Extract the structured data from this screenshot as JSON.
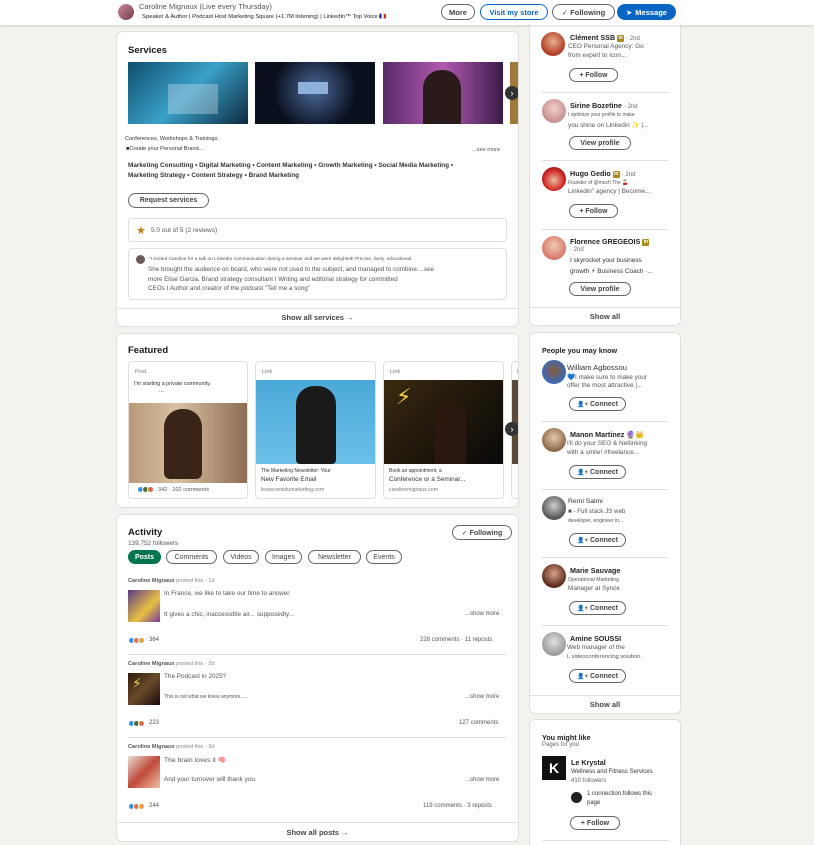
{
  "topbar": {
    "name": "Caroline Mignaux (Live every Thursday)",
    "headline": "Speaker & Author | Podcast Host Marketing Square (+1.7M listening) | LinkedIn™ Top Voice 🇫🇷",
    "more_label": "More",
    "store_label": "Visit my store",
    "following_label": "✓ Following",
    "message_label": "Message"
  },
  "services": {
    "title": "Services",
    "desc_line1": "Conferences, Workshops & Trainings:",
    "desc_line2": "■Create your Personal Brand...",
    "see_more": "...see more",
    "tags_line1": "Marketing Consulting • Digital Marketing • Content Marketing • Growth Marketing • Social Media Marketing •",
    "tags_line2": "Marketing Strategy • Content Strategy • Brand Marketing",
    "request_label": "Request services",
    "rating": "5.0 out of 5 (2 reviews)",
    "review_head": "\"I invited Caroline for a talk on LinkedIn communication during a seminar and we were delighted! Precise, lively, educational.",
    "review_l1": "She brought the audience on board, who were not used to the subject, and managed to combine....see",
    "review_l2": "more Elise Garcia, Brand strategy consultant I Writing and editorial strategy for committed",
    "review_l3": "CEOs I Author and creator of the podcast \"Tell me a song\"",
    "show_all": "Show all services →"
  },
  "featured": {
    "title": "Featured",
    "items": [
      {
        "type": "Post",
        "text": "I'm starting a private community.",
        "dots": "...",
        "reactions": "342 · 102 comments"
      },
      {
        "type": "Link",
        "caption1": "The Marketing Newsletter: Your",
        "caption2": "New Favorite Email",
        "domain": "lessecretsdumarketing.com"
      },
      {
        "type": "Link",
        "caption1": "Book an appointment, a",
        "caption2": "Conference or a Seminar...",
        "domain": "carolinemignaux.com"
      },
      {
        "type": "L"
      }
    ]
  },
  "activity": {
    "title": "Activity",
    "followers": "139,752 followers",
    "following_label": "✓ Following",
    "tabs": [
      "Posts",
      "Comments",
      "Videos",
      "Images",
      "Newsletter",
      "Events"
    ],
    "posts": [
      {
        "author": "Caroline Mignaux",
        "meta": " posted this · 1d",
        "l1": "In France, we like to take our time to answer.",
        "l2": "It gives a chic, inaccessible air... supposedly...",
        "more": "...show more",
        "count": "364",
        "stats": "228 comments · 11 reposts"
      },
      {
        "author": "Caroline Mignaux",
        "meta": " posted this · 2d",
        "l1": "The Podcast in 2025?",
        "l2": "This is not what we knew anymore.....",
        "more": "...show more",
        "count": "223",
        "stats": "127 comments"
      },
      {
        "author": "Caroline Mignaux",
        "meta": " posted this · 3d",
        "l1": "The brain loves it 🧠",
        "l2": "And your turnover will thank you.",
        "more": "...show more",
        "count": "244",
        "stats": "119 comments · 3 reposts"
      }
    ],
    "show_all": "Show all posts →"
  },
  "sidebar_top": {
    "people": [
      {
        "name": "Clément SSB",
        "degree": "· 2nd",
        "l1": "CEO Personal Agency: Go",
        "l2": "from expert to icon...",
        "button": "+ Follow"
      },
      {
        "name": "Sirine Bozetine",
        "degree": "· 2nd",
        "l1": "I optimize your profile to make",
        "l2": "you shine on Linkedin ✨ |...",
        "button": "View profile"
      },
      {
        "name": "Hugo Gedio",
        "degree": "· 2nd",
        "l1": "Founder of @much The 🍒",
        "l2": "Linkedin\" agency | Become...",
        "button": "+ Follow"
      },
      {
        "name": "Florence GREGEOIS",
        "degree": "· 2nd",
        "l1": "I skyrocket your business",
        "l2": "growth ⚡ Business Coach ·...",
        "button": "View profile"
      }
    ],
    "show_all": "Show all"
  },
  "pymk": {
    "title": "People you may know",
    "people": [
      {
        "name": "William Agbossou",
        "l1": "💙I make sure to make your",
        "l2": "offer the most attractive |...",
        "button": "Connect"
      },
      {
        "name": "Manon Martinez 🔮👑",
        "l1": "I'll do your SEO & Netlinking",
        "l2": "with a smile! #freelance...",
        "button": "Connect"
      },
      {
        "name": "Remi Salmi",
        "l1": "■ - Full stack JS web",
        "l2": "developer, engineer in...",
        "button": "Connect"
      },
      {
        "name": "Marie Sauvage",
        "l1": "Operational Marketing",
        "l2": "Manager at Synox",
        "button": "Connect"
      },
      {
        "name": "Amine SOUSSI",
        "l1": "Web manager of the",
        "l2": "L videoconferencing solution.",
        "button": "Connect"
      }
    ],
    "show_all": "Show all"
  },
  "ymlike": {
    "title": "You might like",
    "subtitle": "Pages for you",
    "page_name": "Le Krystal",
    "page_desc": "Wellness and Fitness Services",
    "followers": "410 followers",
    "conn_l1": "1 connection follows this",
    "conn_l2": "page",
    "button": "+ Follow"
  },
  "colors": {
    "accent": "#0a66c2",
    "active_tab": "#01754f",
    "rating_star": "#c37d16"
  }
}
